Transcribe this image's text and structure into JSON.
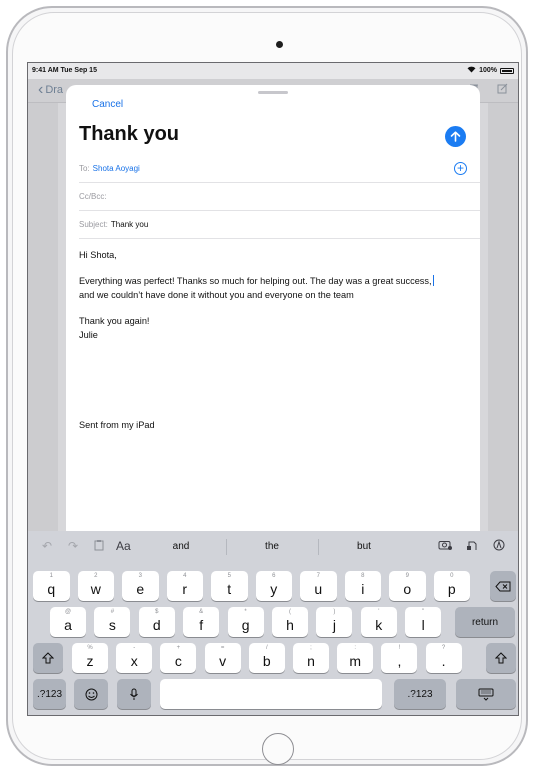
{
  "status_bar": {
    "time": "9:41 AM  Tue Sep 15",
    "battery": "100%"
  },
  "background_app": {
    "back_label": "Dra"
  },
  "compose": {
    "cancel_label": "Cancel",
    "subject_title": "Thank you",
    "to_label": "To:",
    "to_value": "Shota Aoyagi",
    "ccbcc_label": "Cc/Bcc:",
    "subject_label": "Subject:",
    "subject_value": "Thank you",
    "body": {
      "greeting": "Hi Shota,",
      "paragraph_line1": "Everything was perfect! Thanks so much for helping out. The day was a great success,",
      "paragraph_line2": " and we couldn’t have done it without you and everyone on the team",
      "closing_line1": "Thank you again!",
      "closing_line2": "Julie",
      "signature": "Sent from my iPad"
    }
  },
  "keyboard": {
    "format_label": "Aa",
    "suggestions": [
      "and",
      "the",
      "but"
    ],
    "row1": [
      {
        "hint": "1",
        "key": "q"
      },
      {
        "hint": "2",
        "key": "w"
      },
      {
        "hint": "3",
        "key": "e"
      },
      {
        "hint": "4",
        "key": "r"
      },
      {
        "hint": "5",
        "key": "t"
      },
      {
        "hint": "6",
        "key": "y"
      },
      {
        "hint": "7",
        "key": "u"
      },
      {
        "hint": "8",
        "key": "i"
      },
      {
        "hint": "9",
        "key": "o"
      },
      {
        "hint": "0",
        "key": "p"
      }
    ],
    "row2": [
      {
        "hint": "@",
        "key": "a"
      },
      {
        "hint": "#",
        "key": "s"
      },
      {
        "hint": "$",
        "key": "d"
      },
      {
        "hint": "&",
        "key": "f"
      },
      {
        "hint": "*",
        "key": "g"
      },
      {
        "hint": "(",
        "key": "h"
      },
      {
        "hint": ")",
        "key": "j"
      },
      {
        "hint": "'",
        "key": "k"
      },
      {
        "hint": "\"",
        "key": "l"
      }
    ],
    "row3": [
      {
        "hint": "%",
        "key": "z"
      },
      {
        "hint": "-",
        "key": "x"
      },
      {
        "hint": "+",
        "key": "c"
      },
      {
        "hint": "=",
        "key": "v"
      },
      {
        "hint": "/",
        "key": "b"
      },
      {
        "hint": ";",
        "key": "n"
      },
      {
        "hint": ":",
        "key": "m"
      },
      {
        "hint": "!",
        "key": ","
      },
      {
        "hint": "?",
        "key": "."
      }
    ],
    "return_label": "return",
    "numbers_label": ".?123",
    "accent_color": "#1b7cf2"
  }
}
